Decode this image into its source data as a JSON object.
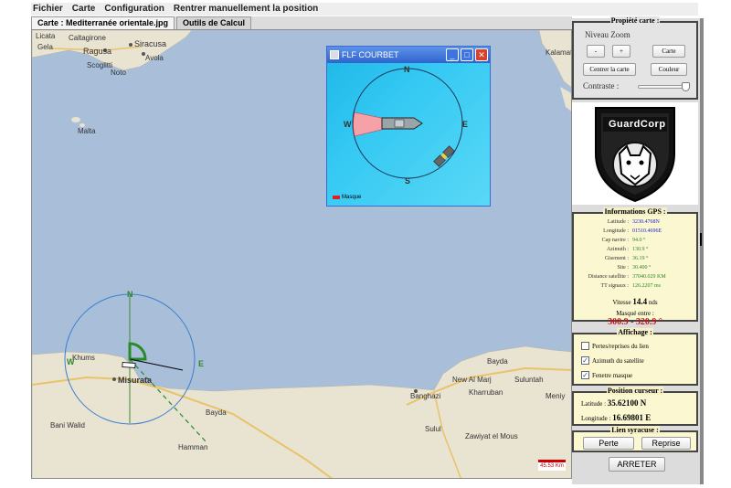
{
  "menu": [
    "Fichier",
    "Carte",
    "Configuration",
    "Rentrer manuellement la position"
  ],
  "tabs": [
    "Carte : Mediterranée orientale.jpg",
    "Outils de Calcul"
  ],
  "map": {
    "labels": {
      "licata": "Licata",
      "caltagirone": "Caltagirone",
      "siracusa": "Siracusa",
      "ragusa": "Ragusa",
      "gela": "Gela",
      "avola": "Avola",
      "scoglitti": "Scoglitti",
      "noto": "Noto",
      "malta": "Malta",
      "kalamata": "Kalamata",
      "misurata": "Misurata",
      "khums": "Khums",
      "banghazi": "Banghazi",
      "bayda": "Bayda",
      "new_al_marj": "New Al Marj",
      "suluntah": "Suluntah",
      "kharruban": "Kharruban",
      "meniy": "Meniy",
      "bani_walid": "Bani Walid",
      "zawiyat": "Zawiyat el Mous",
      "sulul": "Sulul",
      "hamman": "Hamman",
      "bayda_tr": "Bayda",
      "w_label": "W",
      "e_label": "E",
      "n_label": "N"
    },
    "scale": "45.53 Km"
  },
  "flf": {
    "title": "FLF COURBET",
    "min": "_",
    "max": "□",
    "close": "✕",
    "n": "N",
    "s": "S",
    "w": "W",
    "e": "E",
    "legend": "Masque"
  },
  "props": {
    "title": "Propiété carte :",
    "zoom_label": "Niveau Zoom",
    "minus": "-",
    "plus": "+",
    "carte": "Carte",
    "centrer": "Centrer la carte",
    "couleur": "Couleur",
    "contraste": "Contraste :",
    "contraste_value": 1.0
  },
  "logo": "GuardCorp",
  "gps": {
    "title": "Informations GPS :",
    "rows": [
      {
        "k": "Latitude :",
        "v": "3230.4768N"
      },
      {
        "k": "Longitude :",
        "v": "01510.4696E"
      },
      {
        "k": "Cap navire :",
        "v": "94.0 °"
      },
      {
        "k": "Azimuth :",
        "v": "130.9 °"
      },
      {
        "k": "Gisement :",
        "v": "36.19 °"
      },
      {
        "k": "Site :",
        "v": "30.400 °"
      },
      {
        "k": "Distance satellite :",
        "v": "37040.029 KM"
      },
      {
        "k": "TT signaux :",
        "v": "126.2207   ms"
      }
    ],
    "vitesse_label": "Vitesse",
    "vitesse_value": "14.4",
    "vitesse_unit": "nds",
    "masque_label": "Masqué entre :",
    "masque_value": "300.9 - 320.9 °"
  },
  "affichage": {
    "title": "Affichage :",
    "items": [
      {
        "label": "Pertes/reprises du lien",
        "checked": false
      },
      {
        "label": "Azimuth du satellite",
        "checked": true
      },
      {
        "label": "Fenetre masque",
        "checked": true
      }
    ]
  },
  "position": {
    "title": "Position curseur :",
    "lat_label": "Latitude :",
    "lat_value": "35.62100 N",
    "lon_label": "Longitude :",
    "lon_value": "16.69801 E"
  },
  "lien": {
    "title": "Lien syracuse :",
    "perte": "Perte",
    "reprise": "Reprise"
  },
  "arreter": "ARRETER"
}
